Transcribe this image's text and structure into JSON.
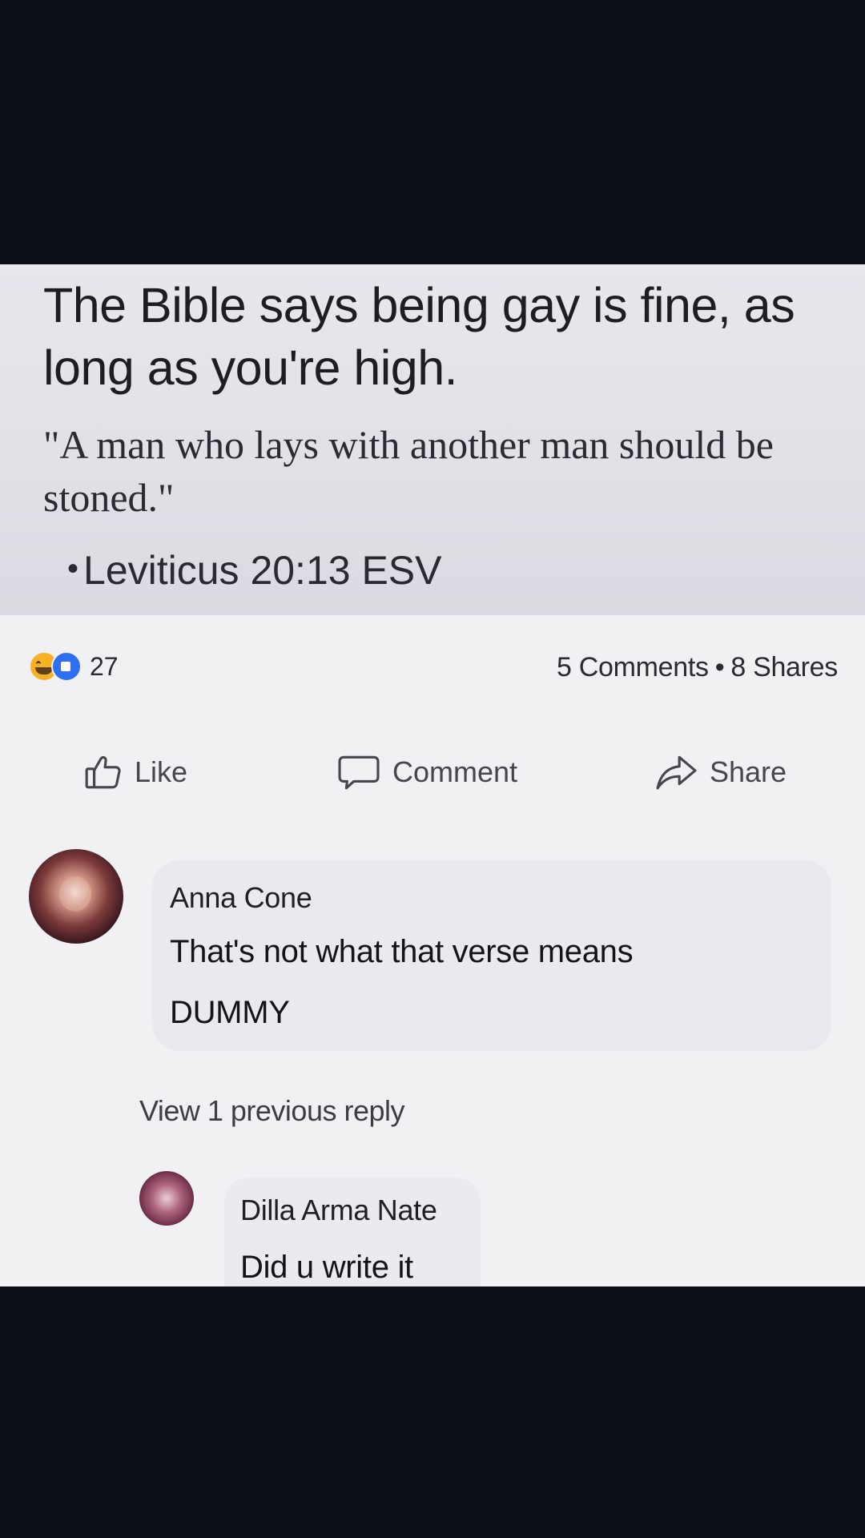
{
  "post": {
    "headline": "The Bible says being gay is fine, as long as you're high.",
    "quote": "\"A man who lays with another man should be stoned.\"",
    "citation": "Leviticus 20:13 ESV"
  },
  "stats": {
    "reactions": [
      "haha-icon",
      "like-icon"
    ],
    "reaction_count": "27",
    "comments": "5 Comments",
    "shares": "8 Shares"
  },
  "actions": {
    "like_label": "Like",
    "comment_label": "Comment",
    "share_label": "Share"
  },
  "comments": [
    {
      "author": "Anna Cone",
      "lines": [
        "That's not what that verse means",
        "DUMMY"
      ]
    }
  ],
  "view_replies_label": "View 1 previous reply",
  "reply": {
    "author": "Dilla Arma Nate",
    "text": "Did u write it"
  },
  "colors": {
    "background": "#0d0f16",
    "card": "#f1f1f4",
    "bubble": "#e9eaef",
    "like_blue": "#2e6ff2",
    "haha_yellow": "#f7b125"
  }
}
